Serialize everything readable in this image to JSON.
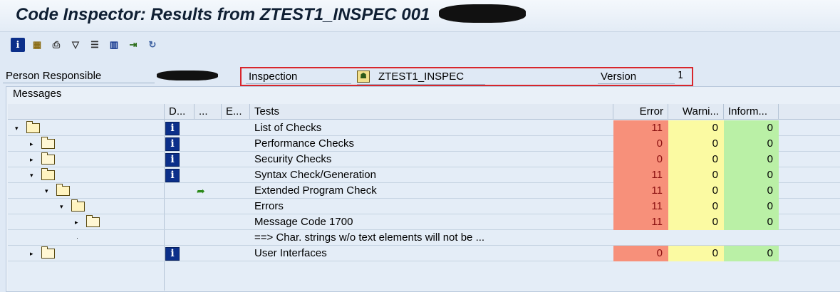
{
  "window": {
    "title": "Code Inspector: Results from ZTEST1_INSPEC 001"
  },
  "toolbar": {
    "buttons": [
      {
        "icon": "info-icon",
        "symbol": "i",
        "color": "#0b2f8a"
      },
      {
        "icon": "hierarchy-icon",
        "symbol": "▦",
        "color": "#8a6a10"
      },
      {
        "icon": "print-icon",
        "symbol": "⎙",
        "color": "#333333"
      },
      {
        "icon": "filter-icon",
        "symbol": "▽",
        "color": "#333333"
      },
      {
        "icon": "list-icon",
        "symbol": "☰",
        "color": "#333333"
      },
      {
        "icon": "columns-icon",
        "symbol": "▥",
        "color": "#0b2f8a"
      },
      {
        "icon": "export-icon",
        "symbol": "⇥",
        "color": "#2c6e1a"
      },
      {
        "icon": "refresh-icon",
        "symbol": "↻",
        "color": "#3b5fa0"
      }
    ]
  },
  "header": {
    "person_label": "Person Responsible",
    "inspection_label": "Inspection",
    "inspection_value": "ZTEST1_INSPEC",
    "version_label": "Version",
    "version_value": "1"
  },
  "messages": {
    "title": "Messages",
    "columns": [
      "D...",
      "...",
      "E...",
      "Tests",
      "Error",
      "Warni...",
      "Inform..."
    ],
    "rows": [
      {
        "indent": 0,
        "expand": "▾",
        "folder": true,
        "icon": "info",
        "test": "List of Checks",
        "error": "11",
        "warning": "0",
        "info": "0"
      },
      {
        "indent": 1,
        "expand": "▸",
        "folder": true,
        "icon": "info",
        "test": "Performance Checks",
        "error": "0",
        "warning": "0",
        "info": "0"
      },
      {
        "indent": 1,
        "expand": "▸",
        "folder": true,
        "icon": "info",
        "test": "Security Checks",
        "error": "0",
        "warning": "0",
        "info": "0"
      },
      {
        "indent": 1,
        "expand": "▾",
        "folder": true,
        "icon": "info",
        "test": "Syntax Check/Generation",
        "error": "11",
        "warning": "0",
        "info": "0"
      },
      {
        "indent": 2,
        "expand": "▾",
        "folder": true,
        "icon": "edit",
        "test": "Extended Program Check",
        "error": "11",
        "warning": "0",
        "info": "0"
      },
      {
        "indent": 3,
        "expand": "▾",
        "folder": true,
        "icon": "",
        "test": "Errors",
        "error": "11",
        "warning": "0",
        "info": "0"
      },
      {
        "indent": 4,
        "expand": "▸",
        "folder": true,
        "icon": "",
        "test": "Message Code 1700",
        "error": "11",
        "warning": "0",
        "info": "0"
      },
      {
        "indent": 4,
        "expand": "·",
        "folder": false,
        "icon": "",
        "test": "==> Char. strings w/o text elements will not be ...",
        "error": "",
        "warning": "",
        "info": ""
      },
      {
        "indent": 1,
        "expand": "▸",
        "folder": true,
        "icon": "info",
        "test": "User Interfaces",
        "error": "0",
        "warning": "0",
        "info": "0"
      }
    ]
  },
  "colors": {
    "error_bg": "#f7907a",
    "warning_bg": "#fbfaa2",
    "info_bg": "#baf0a6",
    "highlight_frame": "#d8262c"
  }
}
